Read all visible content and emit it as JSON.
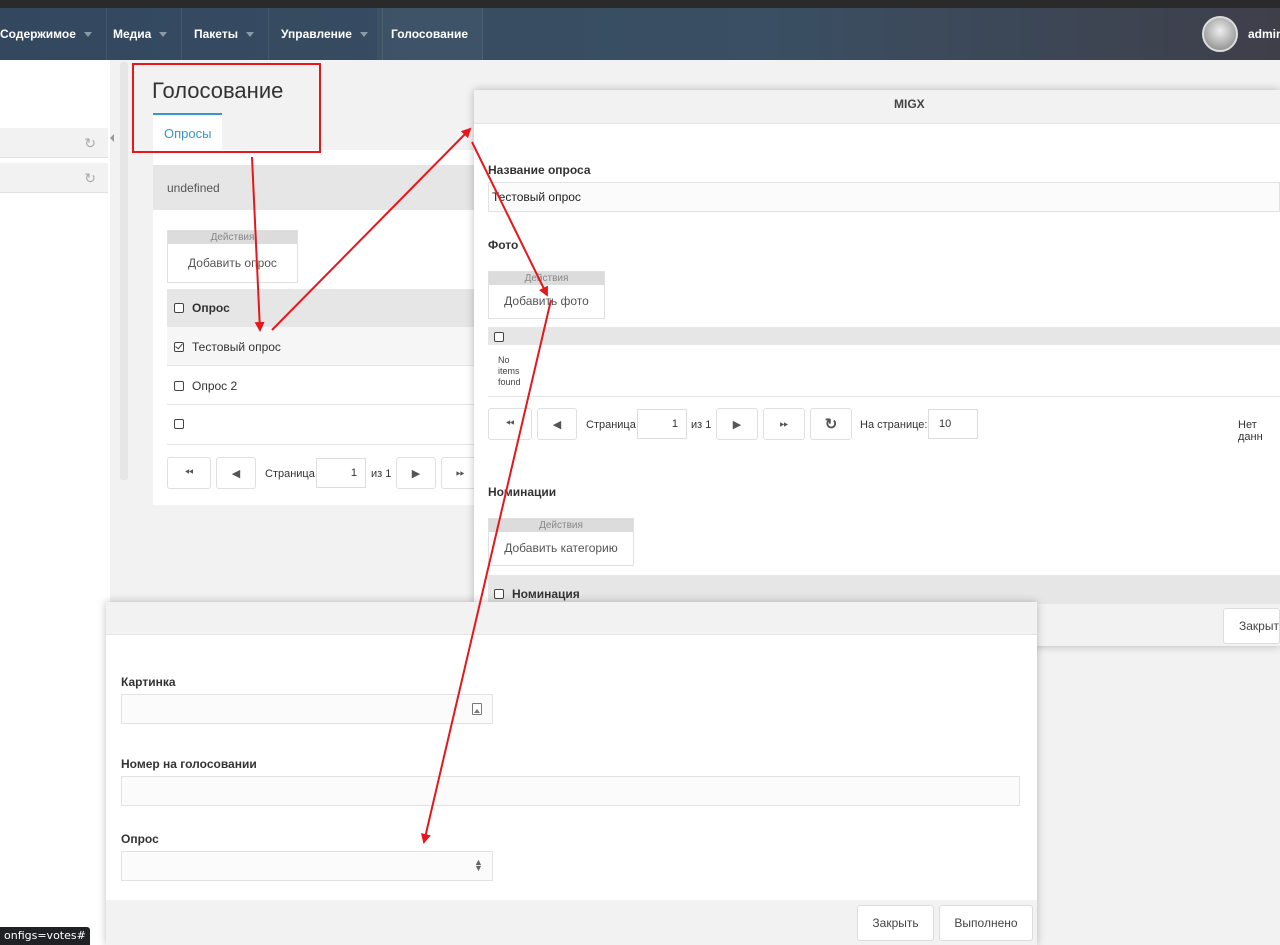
{
  "nav": {
    "items": [
      {
        "label": "Содержимое",
        "has_caret": true
      },
      {
        "label": "Медиа",
        "has_caret": true
      },
      {
        "label": "Пакеты",
        "has_caret": true
      },
      {
        "label": "Управление",
        "has_caret": true
      },
      {
        "label": "Голосование",
        "has_caret": false
      }
    ],
    "username": "admin"
  },
  "page": {
    "title": "Голосование",
    "tabs": [
      "Опросы"
    ],
    "panel_header": "undefined",
    "actions_header": "Действия",
    "add_button": "Добавить опрос",
    "grid": {
      "column": "Опрос",
      "rows": [
        {
          "label": "Тестовый опрос",
          "checked": true
        },
        {
          "label": "Опрос 2",
          "checked": false
        },
        {
          "label": "",
          "checked": false
        }
      ]
    },
    "pager": {
      "page_label": "Страница",
      "page_value": "1",
      "of_label": "из 1"
    }
  },
  "migx": {
    "title": "MIGX",
    "name_label": "Название опроса",
    "name_value": "Тестовый опрос",
    "photo_label": "Фото",
    "photo_actions_header": "Действия",
    "photo_add_button": "Добавить фото",
    "no_items": "No items found",
    "pager": {
      "page_label": "Страница",
      "page_value": "1",
      "of_label": "из 1",
      "per_page_label": "На странице:",
      "per_page_value": "10",
      "no_data": "Нет данн"
    },
    "nominations_label": "Номинации",
    "nominations_actions_header": "Действия",
    "nominations_add_button": "Добавить категорию",
    "nominations_column": "Номинация",
    "close_button": "Закрыт"
  },
  "dialog": {
    "image_label": "Картинка",
    "number_label": "Номер на голосовании",
    "poll_label": "Опрос",
    "close_button": "Закрыть",
    "done_button": "Выполнено"
  },
  "status_url": "onfigs=votes#",
  "colors": {
    "accent": "#3697cd",
    "annotation": "#e8161b",
    "nav_bg": "#33485f"
  }
}
